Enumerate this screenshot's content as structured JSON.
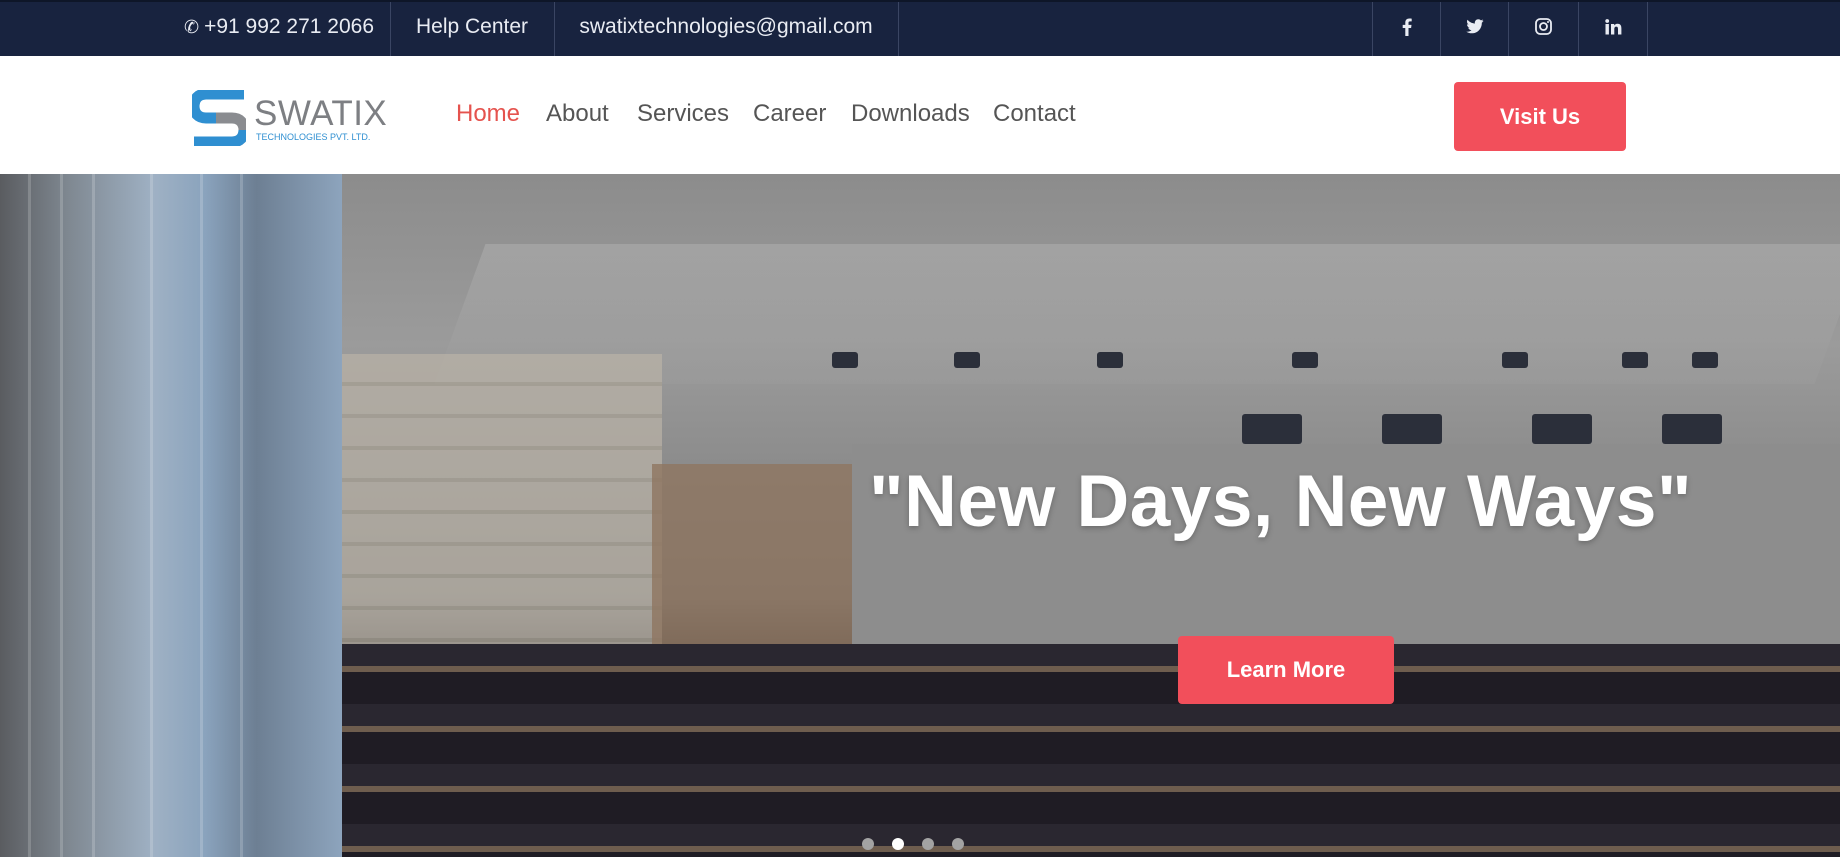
{
  "topbar": {
    "phone": "+91 992 271 2066",
    "help": "Help Center",
    "email": "swatixtechnologies@gmail.com",
    "social": [
      "facebook-icon",
      "twitter-icon",
      "instagram-icon",
      "linkedin-icon"
    ],
    "bg_color": "#18233f"
  },
  "header": {
    "logo_word": "SWATIX",
    "logo_sub": "TECHNOLOGIES PVT. LTD.",
    "nav": [
      "Home",
      "About",
      "Services",
      "Career",
      "Downloads",
      "Contact"
    ],
    "active_nav": "Home",
    "visit_label": "Visit Us",
    "accent_color": "#f24f5b"
  },
  "hero": {
    "title": "\"New Days, New Ways\"",
    "button_label": "Learn More",
    "slides": 4,
    "active_slide": 2
  }
}
